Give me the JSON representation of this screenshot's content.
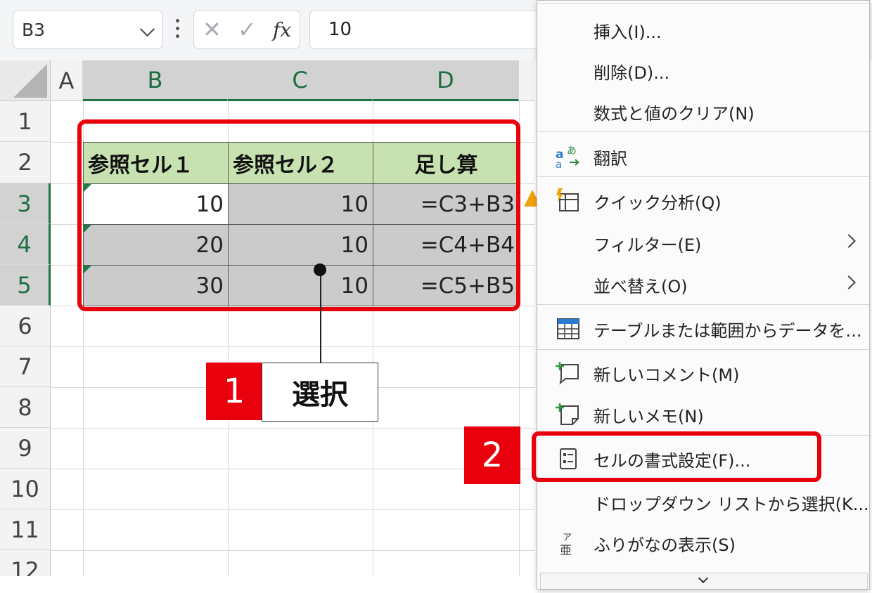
{
  "formula_bar": {
    "name_box": "B3",
    "cancel_icon": "✕",
    "enter_icon": "✓",
    "fx_label": "fx",
    "value": "10"
  },
  "sheet": {
    "columns": [
      "A",
      "B",
      "C",
      "D"
    ],
    "rows": [
      "1",
      "2",
      "3",
      "4",
      "5",
      "6",
      "7",
      "8",
      "9",
      "10",
      "11",
      "12"
    ],
    "header_row": [
      "参照セル１",
      "参照セル２",
      "足し算"
    ],
    "data_rows": [
      [
        "10",
        "10",
        "=C3+B3"
      ],
      [
        "20",
        "10",
        "=C4+B4"
      ],
      [
        "30",
        "10",
        "=C5+B5"
      ]
    ]
  },
  "annotations": {
    "step1_number": "1",
    "step1_label": "選択",
    "step2_number": "2",
    "highlight_color": "#e8000d"
  },
  "context_menu": {
    "items": [
      {
        "label": "挿入(I)...",
        "icon": "none"
      },
      {
        "label": "削除(D)...",
        "icon": "none"
      },
      {
        "label": "数式と値のクリア(N)",
        "icon": "none"
      },
      {
        "label": "翻訳",
        "icon": "translate-icon"
      },
      {
        "label": "クイック分析(Q)",
        "icon": "quick-analysis-icon"
      },
      {
        "label": "フィルター(E)",
        "icon": "none",
        "submenu": true
      },
      {
        "label": "並べ替え(O)",
        "icon": "none",
        "submenu": true
      },
      {
        "label": "テーブルまたは範囲からデータを...",
        "icon": "table-icon"
      },
      {
        "label": "新しいコメント(M)",
        "icon": "new-comment-icon"
      },
      {
        "label": "新しいメモ(N)",
        "icon": "new-note-icon"
      },
      {
        "label": "セルの書式設定(F)...",
        "icon": "format-cells-icon"
      },
      {
        "label": "ドロップダウン リストから選択(K...",
        "icon": "none"
      },
      {
        "label": "ふりがなの表示(S)",
        "icon": "furigana-icon"
      }
    ]
  },
  "colors": {
    "header_fill": "#c7e2b0",
    "selected_fill": "#cbcbcb",
    "excel_green": "#217346"
  }
}
